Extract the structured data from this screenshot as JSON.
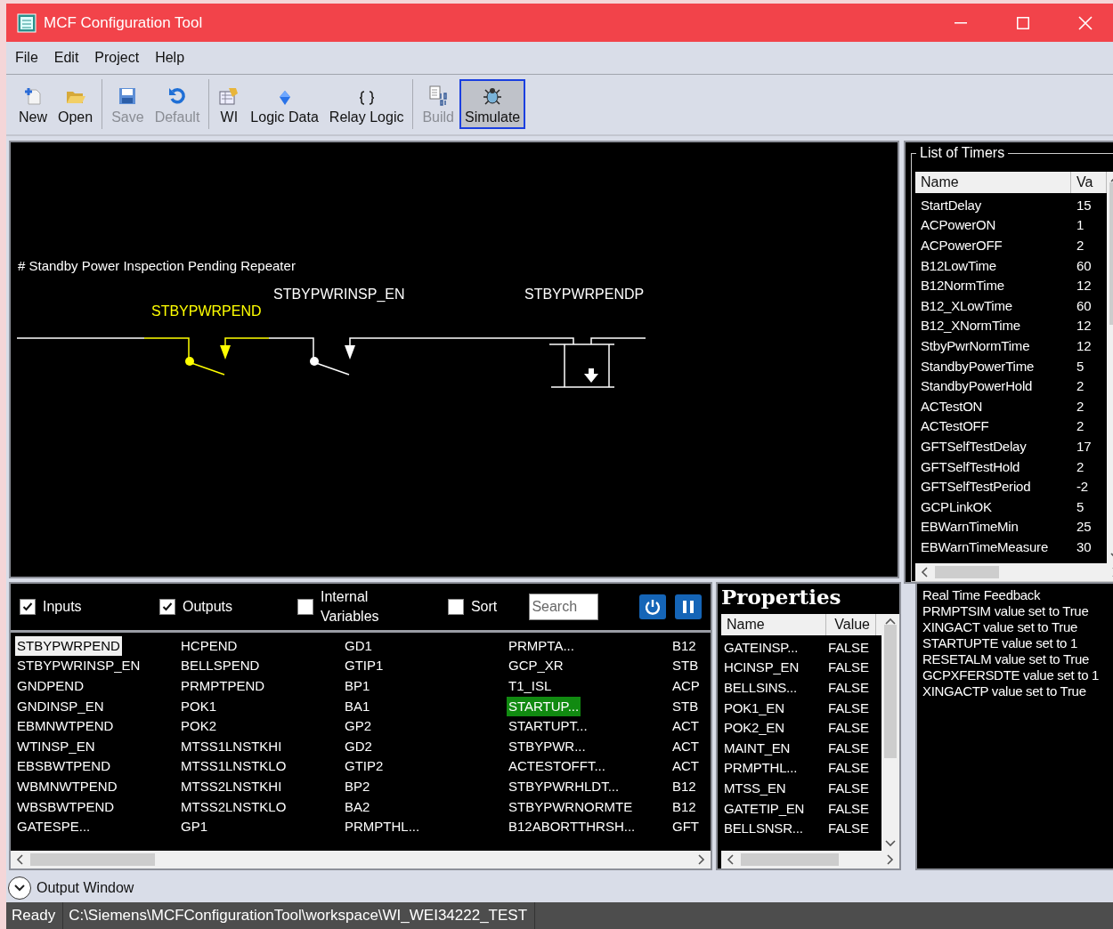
{
  "window": {
    "title": "MCF Configuration Tool"
  },
  "menu": [
    "File",
    "Edit",
    "Project",
    "Help"
  ],
  "toolbar": [
    [
      {
        "label": "New",
        "disabled": false,
        "selected": false
      },
      {
        "label": "Open",
        "disabled": false,
        "selected": false
      }
    ],
    [
      {
        "label": "Save",
        "disabled": true,
        "selected": false
      },
      {
        "label": "Default",
        "disabled": true,
        "selected": false
      }
    ],
    [
      {
        "label": "WI",
        "disabled": false,
        "selected": false
      },
      {
        "label": "Logic Data",
        "disabled": false,
        "selected": false
      },
      {
        "label": "Relay Logic",
        "disabled": false,
        "selected": false
      }
    ],
    [
      {
        "label": "Build",
        "disabled": true,
        "selected": false
      },
      {
        "label": "Simulate",
        "disabled": false,
        "selected": true
      }
    ]
  ],
  "diagram": {
    "comment": "# Standby Power Inspection Pending Repeater",
    "contacts": [
      {
        "label": "STBYPWRPEND",
        "energized": true
      },
      {
        "label": "STBYPWRINSP_EN",
        "energized": false
      }
    ],
    "coil": {
      "label": "STBYPWRPENDP",
      "energized": false
    }
  },
  "timers": {
    "title": "List of Timers",
    "columns": [
      "Name",
      "Va"
    ],
    "rows": [
      [
        "StartDelay",
        "15"
      ],
      [
        "ACPowerON",
        "1"
      ],
      [
        "ACPowerOFF",
        "2"
      ],
      [
        "B12LowTime",
        "60"
      ],
      [
        "B12NormTime",
        "12"
      ],
      [
        "B12_XLowTime",
        "60"
      ],
      [
        "B12_XNormTime",
        "12"
      ],
      [
        "StbyPwrNormTime",
        "12"
      ],
      [
        "StandbyPowerTime",
        "5"
      ],
      [
        "StandbyPowerHold",
        "2"
      ],
      [
        "ACTestON",
        "2"
      ],
      [
        "ACTestOFF",
        "2"
      ],
      [
        "GFTSelfTestDelay",
        "17"
      ],
      [
        "GFTSelfTestHold",
        "2"
      ],
      [
        "GFTSelfTestPeriod",
        "-2"
      ],
      [
        "GCPLinkOK",
        "5"
      ],
      [
        "EBWarnTimeMin",
        "25"
      ],
      [
        "EBWarnTimeMeasure",
        "30"
      ]
    ]
  },
  "filters": [
    {
      "label": "Inputs",
      "checked": true
    },
    {
      "label": "Outputs",
      "checked": true
    },
    {
      "label": "Internal Variables",
      "checked": false
    },
    {
      "label": "Sort",
      "checked": false
    }
  ],
  "search": {
    "placeholder": "Search"
  },
  "variables": [
    [
      {
        "name": "STBYPWRPEND",
        "selected": true,
        "active": false
      },
      {
        "name": "STBYPWRINSP_EN",
        "selected": false,
        "active": false
      },
      {
        "name": "GNDPEND",
        "selected": false,
        "active": false
      },
      {
        "name": "GNDINSP_EN",
        "selected": false,
        "active": false
      },
      {
        "name": "EBMNWTPEND",
        "selected": false,
        "active": false
      },
      {
        "name": "WTINSP_EN",
        "selected": false,
        "active": false
      },
      {
        "name": "EBSBWTPEND",
        "selected": false,
        "active": false
      },
      {
        "name": "WBMNWTPEND",
        "selected": false,
        "active": false
      },
      {
        "name": "WBSBWTPEND",
        "selected": false,
        "active": false
      },
      {
        "name": "GATESPE...",
        "selected": false,
        "active": false
      }
    ],
    [
      {
        "name": "HCPEND",
        "selected": false,
        "active": false
      },
      {
        "name": "BELLSPEND",
        "selected": false,
        "active": false
      },
      {
        "name": "PRMPTPEND",
        "selected": false,
        "active": false
      },
      {
        "name": "POK1",
        "selected": false,
        "active": false
      },
      {
        "name": "POK2",
        "selected": false,
        "active": false
      },
      {
        "name": "MTSS1LNSTKHI",
        "selected": false,
        "active": false
      },
      {
        "name": "MTSS1LNSTKLO",
        "selected": false,
        "active": false
      },
      {
        "name": "MTSS2LNSTKHI",
        "selected": false,
        "active": false
      },
      {
        "name": "MTSS2LNSTKLO",
        "selected": false,
        "active": false
      },
      {
        "name": "GP1",
        "selected": false,
        "active": false
      }
    ],
    [
      {
        "name": "GD1",
        "selected": false,
        "active": false
      },
      {
        "name": "GTIP1",
        "selected": false,
        "active": false
      },
      {
        "name": "BP1",
        "selected": false,
        "active": false
      },
      {
        "name": "BA1",
        "selected": false,
        "active": false
      },
      {
        "name": "GP2",
        "selected": false,
        "active": false
      },
      {
        "name": "GD2",
        "selected": false,
        "active": false
      },
      {
        "name": "GTIP2",
        "selected": false,
        "active": false
      },
      {
        "name": "BP2",
        "selected": false,
        "active": false
      },
      {
        "name": "BA2",
        "selected": false,
        "active": false
      },
      {
        "name": "PRMPTHL...",
        "selected": false,
        "active": false
      }
    ],
    [
      {
        "name": "PRMPTA...",
        "selected": false,
        "active": false
      },
      {
        "name": "GCP_XR",
        "selected": false,
        "active": false
      },
      {
        "name": "T1_ISL",
        "selected": false,
        "active": false
      },
      {
        "name": "STARTUP...",
        "selected": false,
        "active": true
      },
      {
        "name": "STARTUPT...",
        "selected": false,
        "active": false
      },
      {
        "name": "STBYPWR...",
        "selected": false,
        "active": false
      },
      {
        "name": "ACTESTOFFT...",
        "selected": false,
        "active": false
      },
      {
        "name": "STBYPWRHLDT...",
        "selected": false,
        "active": false
      },
      {
        "name": "STBYPWRNORMTE",
        "selected": false,
        "active": false
      },
      {
        "name": "B12ABORTTHRSH...",
        "selected": false,
        "active": false
      }
    ],
    [
      {
        "name": "B12",
        "selected": false,
        "active": false
      },
      {
        "name": "STB",
        "selected": false,
        "active": false
      },
      {
        "name": "ACP",
        "selected": false,
        "active": false
      },
      {
        "name": "STB",
        "selected": false,
        "active": false
      },
      {
        "name": "ACT",
        "selected": false,
        "active": false
      },
      {
        "name": "ACT",
        "selected": false,
        "active": false
      },
      {
        "name": "ACT",
        "selected": false,
        "active": false
      },
      {
        "name": "B12",
        "selected": false,
        "active": false
      },
      {
        "name": "B12",
        "selected": false,
        "active": false
      },
      {
        "name": "GFT",
        "selected": false,
        "active": false
      }
    ]
  ],
  "properties": {
    "title": "Properties",
    "columns": [
      "Name",
      "Value"
    ],
    "rows": [
      [
        "GATEINSP...",
        "FALSE"
      ],
      [
        "HCINSP_EN",
        "FALSE"
      ],
      [
        "BELLSINS...",
        "FALSE"
      ],
      [
        "POK1_EN",
        "FALSE"
      ],
      [
        "POK2_EN",
        "FALSE"
      ],
      [
        "MAINT_EN",
        "FALSE"
      ],
      [
        "PRMPTHL...",
        "FALSE"
      ],
      [
        "MTSS_EN",
        "FALSE"
      ],
      [
        "GATETIP_EN",
        "FALSE"
      ],
      [
        "BELLSNSR...",
        "FALSE"
      ]
    ]
  },
  "feedback": {
    "title": "Real Time Feedback",
    "lines": [
      "PRMPTSIM value set to True",
      "XINGACT value set to True",
      "STARTUPTE value set to 1",
      "RESETALM value set to True",
      "GCPXFERSDTE value set to 1",
      "XINGACTP value set to True"
    ]
  },
  "output_window": {
    "label": "Output Window",
    "expanded": false
  },
  "status_bar": {
    "state": "Ready",
    "path": "C:\\Siemens\\MCFConfigurationTool\\workspace\\WI_WEI34222_TEST"
  }
}
